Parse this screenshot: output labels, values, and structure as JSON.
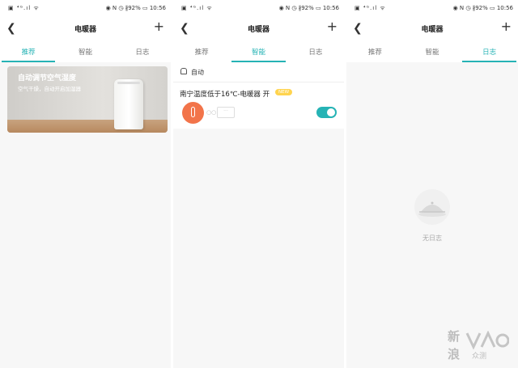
{
  "status_bar": {
    "left": "▣ ⁴ᴳ.ıl ᯤ",
    "right": "◉ N ◷ ∦92% ▭ 10:56"
  },
  "screens": [
    {
      "header": {
        "title": "电暖器",
        "back_icon": "chevron-left-icon",
        "add_icon": "plus-icon"
      },
      "tabs": [
        "推荐",
        "智能",
        "日志"
      ],
      "active_tab": 0,
      "card": {
        "title": "自动调节空气湿度",
        "subtitle": "空气干燥，自动开启加湿器"
      }
    },
    {
      "header": {
        "title": "电暖器",
        "back_icon": "chevron-left-icon",
        "add_icon": "plus-icon"
      },
      "tabs": [
        "推荐",
        "智能",
        "日志"
      ],
      "active_tab": 1,
      "section_label": "自动",
      "rule": {
        "title": "南宁温度低于16℃-电暖器 开",
        "badge": "NEW",
        "enabled": true,
        "link": "○○",
        "device_text": "···"
      }
    },
    {
      "header": {
        "title": "电暖器",
        "back_icon": "chevron-left-icon",
        "add_icon": "plus-icon"
      },
      "tabs": [
        "推荐",
        "智能",
        "日志"
      ],
      "active_tab": 2,
      "empty_text": "无日志"
    }
  ],
  "watermark": {
    "top": "新",
    "bottom": "浪",
    "logo": "众测"
  },
  "colors": {
    "accent": "#26b3b5",
    "thermo": "#f2744a",
    "badge": "#ffd44f"
  }
}
